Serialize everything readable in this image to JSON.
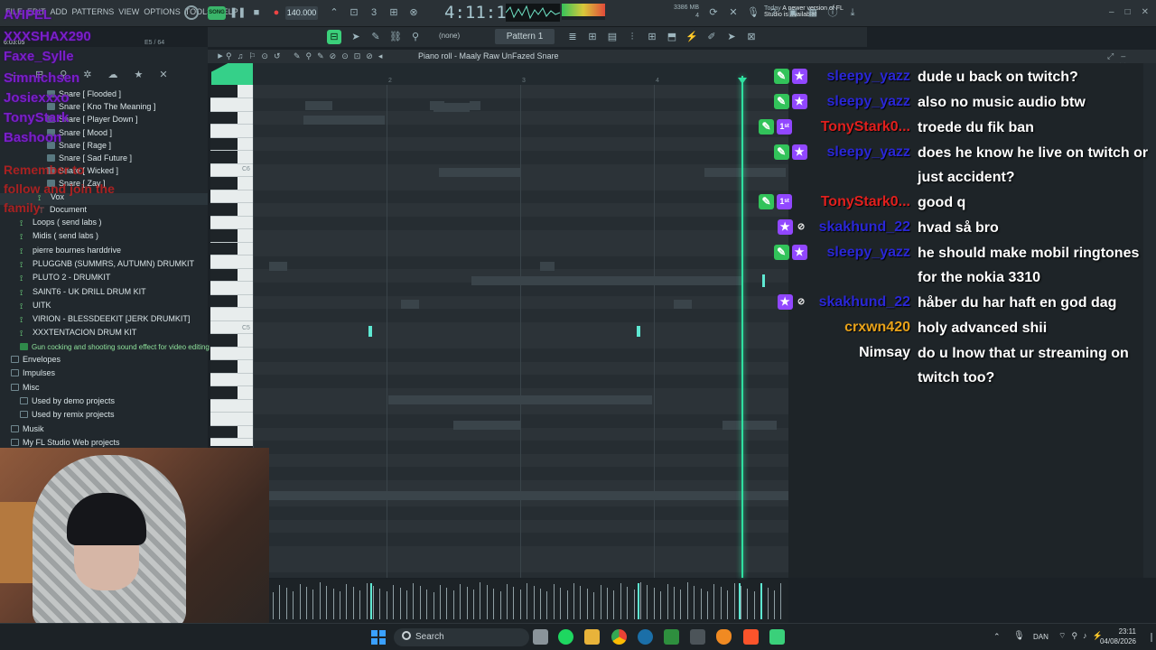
{
  "menu": [
    "FILE",
    "EDIT",
    "ADD",
    "PATTERNS",
    "VIEW",
    "OPTIONS",
    "TOOLS",
    "HELP"
  ],
  "transport": {
    "mode": "SONG",
    "tempo": "140.000",
    "time": "4:11:11",
    "time_sub": "B:S:T"
  },
  "cpu": {
    "mem": "3386 MB",
    "poly": "4"
  },
  "news": {
    "date": "Today",
    "text": "A newer version of FL Studio is available!"
  },
  "toolbar2": {
    "snap": "(none)",
    "pattern": "Pattern 1"
  },
  "browser": {
    "hint": "E5 / 64",
    "top_label": "6:03:05",
    "items": [
      {
        "label": "Snare [ Flooded ]",
        "type": "snare",
        "indent": 52
      },
      {
        "label": "Snare [ Kno The Meaning ]",
        "type": "snare",
        "indent": 52
      },
      {
        "label": "Snare [ Player Down ]",
        "type": "snare",
        "indent": 52
      },
      {
        "label": "Snare [ Mood ]",
        "type": "snare",
        "indent": 52
      },
      {
        "label": "Snare [ Rage ]",
        "type": "snare",
        "indent": 52
      },
      {
        "label": "Snare [ Sad Future ]",
        "type": "snare",
        "indent": 52
      },
      {
        "label": "Snare [ Wicked ]",
        "type": "snare",
        "indent": 52
      },
      {
        "label": "Snare [ Zay ]",
        "type": "snare",
        "indent": 52
      },
      {
        "label": "Vox",
        "type": "kit",
        "indent": 42
      },
      {
        "label": "Document",
        "type": "doc",
        "indent": 42
      },
      {
        "label": "Loops ( send labs )",
        "type": "kit",
        "indent": 22
      },
      {
        "label": "Midis ( send labs )",
        "type": "kit",
        "indent": 22
      },
      {
        "label": "pierre bournes harddrive",
        "type": "kit",
        "indent": 22
      },
      {
        "label": "PLUGGNB (SUMMRS, AUTUMN) DRUMKIT",
        "type": "kit",
        "indent": 22
      },
      {
        "label": "PLUTO 2 - DRUMKIT",
        "type": "kit",
        "indent": 22
      },
      {
        "label": "SAINT6 - UK DRILL DRUM KIT",
        "type": "kit",
        "indent": 22
      },
      {
        "label": "UITK",
        "type": "kit",
        "indent": 22
      },
      {
        "label": "VIRION - BLESSDEEKIT [JERK DRUMKIT]",
        "type": "kit",
        "indent": 22
      },
      {
        "label": "XXXTENTACION DRUM KIT",
        "type": "kit",
        "indent": 22
      },
      {
        "label": "Gun cocking and shooting sound effect for video editing",
        "type": "audio",
        "indent": 22
      },
      {
        "label": "Envelopes",
        "type": "folder",
        "indent": 12
      },
      {
        "label": "Impulses",
        "type": "folder",
        "indent": 12
      },
      {
        "label": "Misc",
        "type": "folder",
        "indent": 12
      },
      {
        "label": "Used by demo projects",
        "type": "folder",
        "indent": 22
      },
      {
        "label": "Used by remix projects",
        "type": "folder",
        "indent": 22
      },
      {
        "label": "Musik",
        "type": "folder",
        "indent": 12
      },
      {
        "label": "My FL Studio Web projects",
        "type": "folder",
        "indent": 12
      }
    ]
  },
  "overlay_names": [
    "AVIPEL",
    "XXXSHAX290",
    "Faxe_Sylle",
    "Simnichsen",
    "Josiexxxo",
    "TonyStark",
    "Bashoon"
  ],
  "overlay_red": [
    "Remember to",
    "follow and join the",
    "family"
  ],
  "piano_roll": {
    "title": "Piano roll - Maaly Raw UnFazed Snare",
    "key_c6": "C6",
    "key_c5": "C5",
    "bars": [
      "2",
      "3",
      "4"
    ],
    "notes_at": [
      0.22,
      0.72
    ]
  },
  "chat": [
    {
      "user": "sleepy_yazz",
      "color": "#2a27d6",
      "badges": [
        "mod",
        "star"
      ],
      "text": "dude u back on twitch?"
    },
    {
      "user": "sleepy_yazz",
      "color": "#2a27d6",
      "badges": [
        "mod",
        "star"
      ],
      "text": "also no music audio btw"
    },
    {
      "user": "TonyStark0...",
      "color": "#e0201e",
      "badges": [
        "mod",
        "sub"
      ],
      "text": "troede du fik ban"
    },
    {
      "user": "sleepy_yazz",
      "color": "#2a27d6",
      "badges": [
        "mod",
        "star"
      ],
      "text": "does he know he live on twitch or just accident?"
    },
    {
      "user": "TonyStark0...",
      "color": "#e0201e",
      "badges": [
        "mod",
        "sub"
      ],
      "text": "good q"
    },
    {
      "user": "skakhund_22",
      "color": "#2a27d6",
      "badges": [
        "star",
        "eye"
      ],
      "text": "hvad så bro"
    },
    {
      "user": "sleepy_yazz",
      "color": "#2a27d6",
      "badges": [
        "mod",
        "star"
      ],
      "text": "he should make mobil ringtones for the nokia 3310"
    },
    {
      "user": "skakhund_22",
      "color": "#2a27d6",
      "badges": [
        "star",
        "eye"
      ],
      "text": "håber du har haft en god dag"
    },
    {
      "user": "crxwn420",
      "color": "#e8a21a",
      "badges": [],
      "text": "holy advanced shii"
    },
    {
      "user": "Nimsay",
      "color": "#ffffff",
      "badges": [],
      "text": "do u lnow that ur streaming on twitch too?"
    }
  ],
  "taskbar": {
    "search": "Search",
    "lang": "DAN",
    "time": "23:11",
    "date": "04/08/2026"
  }
}
